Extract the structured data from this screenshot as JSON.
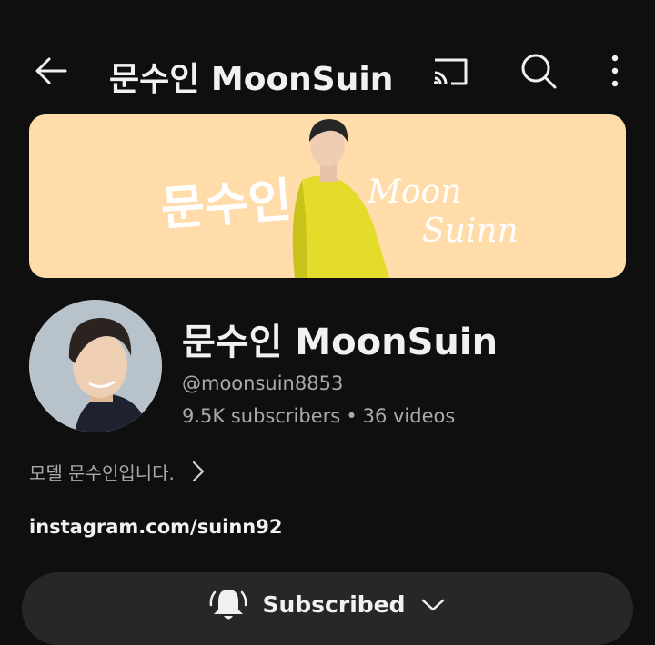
{
  "header": {
    "title": "문수인 MoonSuin",
    "back_icon": "arrow-left-icon",
    "cast_icon": "cast-icon",
    "search_icon": "search-icon",
    "more_icon": "more-vert-icon"
  },
  "banner": {
    "text_left": "문수인",
    "text_right_1": "Moon",
    "text_right_2": "Suinn",
    "background_color": "#ffdcaa"
  },
  "channel": {
    "name": "문수인 MoonSuin",
    "handle": "@moonsuin8853",
    "subscribers": "9.5K subscribers",
    "separator": "•",
    "videos": "36 videos",
    "description": "모델 문수인입니다.",
    "link": "instagram.com/suinn92"
  },
  "subscribe": {
    "label": "Subscribed",
    "bell_icon": "bell-icon",
    "chevron_icon": "chevron-down-icon"
  },
  "colors": {
    "background": "#0f0f0f",
    "text_primary": "#f1f1f1",
    "text_secondary": "#aaaaaa",
    "button_bg": "#272727"
  }
}
